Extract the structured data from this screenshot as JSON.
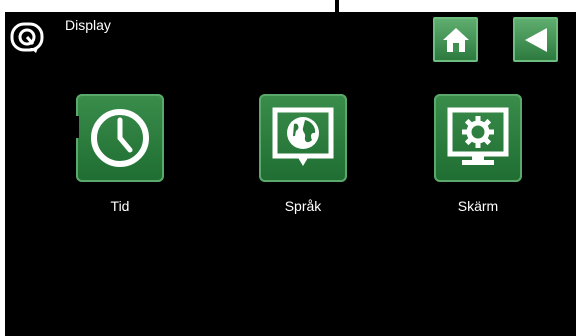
{
  "header": {
    "title": "Display",
    "icon": "display-settings-icon"
  },
  "nav": {
    "home_icon": "home-icon",
    "back_icon": "back-arrow-icon"
  },
  "tiles": [
    {
      "label": "Tid",
      "icon": "clock-icon"
    },
    {
      "label": "Språk",
      "icon": "globe-speech-icon"
    },
    {
      "label": "Skärm",
      "icon": "monitor-gear-icon"
    }
  ],
  "colors": {
    "accent": "#2d7a3f",
    "tile_border": "#5aa86a",
    "background": "#000000"
  }
}
